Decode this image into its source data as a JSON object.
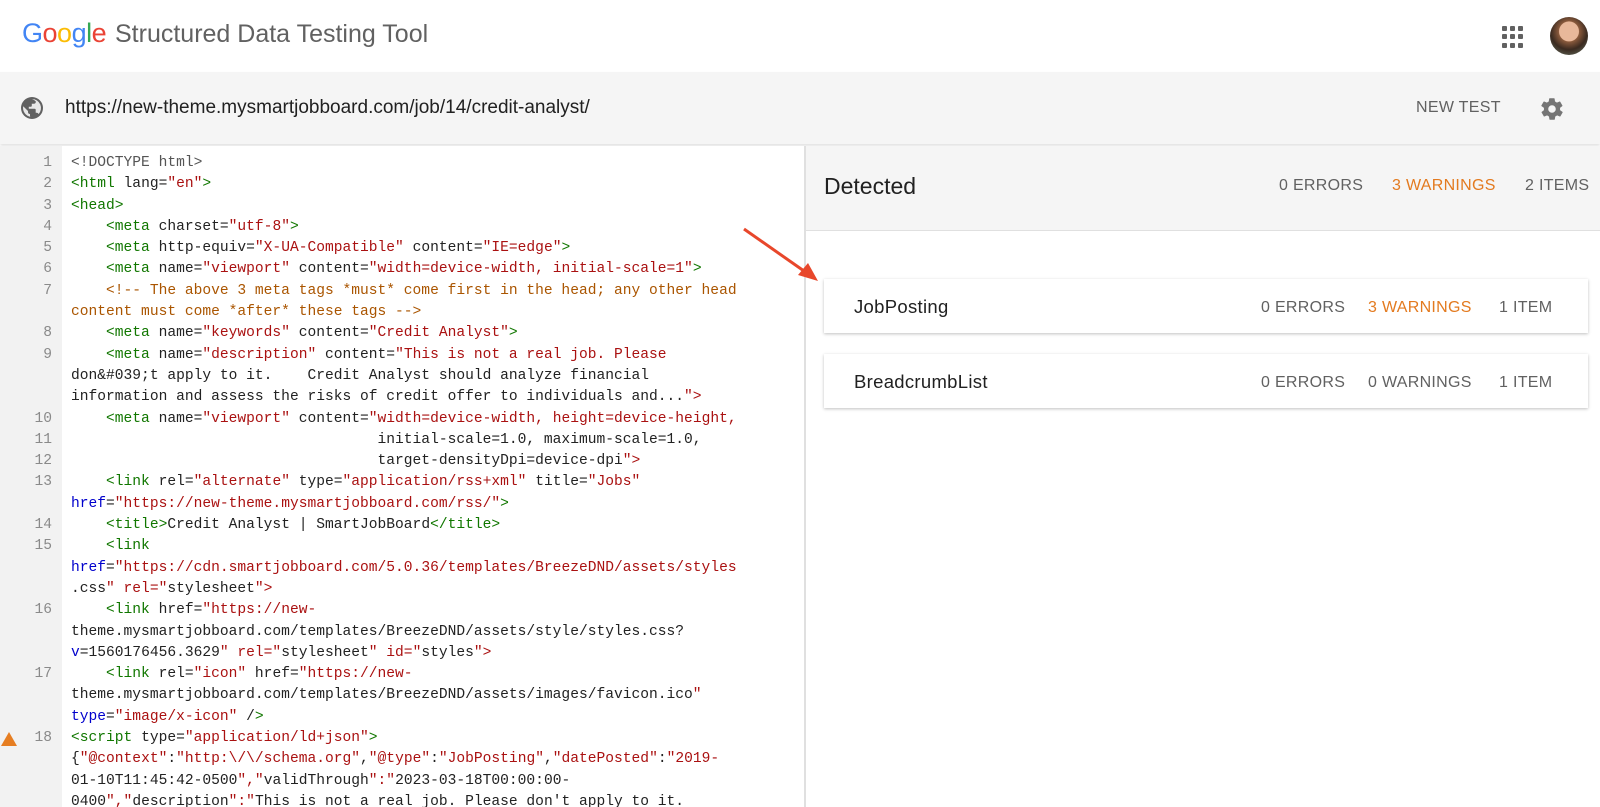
{
  "header": {
    "logo": {
      "G": "G",
      "o1": "o",
      "o2": "o",
      "g": "g",
      "l": "l",
      "e": "e"
    },
    "title": "Structured Data Testing Tool",
    "apps_icon": "apps-grid-icon",
    "avatar": "user-avatar"
  },
  "urlbar": {
    "icon": "globe-icon",
    "url": "https://new-theme.mysmartjobboard.com/job/14/credit-analyst/",
    "new_test_label": "NEW TEST",
    "settings_icon": "gear-icon"
  },
  "code": {
    "lines": [
      {
        "n": "1",
        "text": "<!DOCTYPE html>"
      },
      {
        "n": "2",
        "text": "<html lang=\"en\">"
      },
      {
        "n": "3",
        "text": "<head>"
      },
      {
        "n": "4",
        "text": "    <meta charset=\"utf-8\">"
      },
      {
        "n": "5",
        "text": "    <meta http-equiv=\"X-UA-Compatible\" content=\"IE=edge\">"
      },
      {
        "n": "6",
        "text": "    <meta name=\"viewport\" content=\"width=device-width, initial-scale=1\">"
      },
      {
        "n": "7",
        "text": "    <!-- The above 3 meta tags *must* come first in the head; any other head"
      },
      {
        "n": "",
        "text": "content must come *after* these tags -->"
      },
      {
        "n": "8",
        "text": "    <meta name=\"keywords\" content=\"Credit Analyst\">"
      },
      {
        "n": "9",
        "text": "    <meta name=\"description\" content=\"This is not a real job. Please"
      },
      {
        "n": "",
        "text": "don&#039;t apply to it.    Credit Analyst should analyze financial"
      },
      {
        "n": "",
        "text": "information and assess the risks of credit offer to individuals and...\">"
      },
      {
        "n": "10",
        "text": "    <meta name=\"viewport\" content=\"width=device-width, height=device-height,"
      },
      {
        "n": "11",
        "text": "                                   initial-scale=1.0, maximum-scale=1.0,"
      },
      {
        "n": "12",
        "text": "                                   target-densityDpi=device-dpi\">"
      },
      {
        "n": "13",
        "text": "    <link rel=\"alternate\" type=\"application/rss+xml\" title=\"Jobs\""
      },
      {
        "n": "",
        "text": "href=\"https://new-theme.mysmartjobboard.com/rss/\">"
      },
      {
        "n": "14",
        "text": "    <title>Credit Analyst | SmartJobBoard</title>"
      },
      {
        "n": "15",
        "text": "    <link"
      },
      {
        "n": "",
        "text": "href=\"https://cdn.smartjobboard.com/5.0.36/templates/BreezeDND/assets/styles"
      },
      {
        "n": "",
        "text": ".css\" rel=\"stylesheet\">"
      },
      {
        "n": "16",
        "text": "    <link href=\"https://new-"
      },
      {
        "n": "",
        "text": "theme.mysmartjobboard.com/templates/BreezeDND/assets/style/styles.css?"
      },
      {
        "n": "",
        "text": "v=1560176456.3629\" rel=\"stylesheet\" id=\"styles\">"
      },
      {
        "n": "17",
        "text": "    <link rel=\"icon\" href=\"https://new-"
      },
      {
        "n": "",
        "text": "theme.mysmartjobboard.com/templates/BreezeDND/assets/images/favicon.ico\""
      },
      {
        "n": "",
        "text": "type=\"image/x-icon\" />"
      },
      {
        "n": "18",
        "text": "<script type=\"application/ld+json\">",
        "warn": true
      },
      {
        "n": "",
        "text": "{\"@context\":\"http:\\/\\/schema.org\",\"@type\":\"JobPosting\",\"datePosted\":\"2019-"
      },
      {
        "n": "",
        "text": "01-10T11:45:42-0500\",\"validThrough\":\"2023-03-18T00:00:00-"
      },
      {
        "n": "",
        "text": "0400\",\"description\":\"This is not a real job. Please don't apply to it."
      }
    ]
  },
  "results": {
    "title": "Detected",
    "errors": "0 ERRORS",
    "warnings": "3 WARNINGS",
    "items": "2 ITEMS",
    "cards": [
      {
        "name": "JobPosting",
        "errors": "0 ERRORS",
        "warnings": "3 WARNINGS",
        "items": "1 ITEM",
        "has_warnings": true
      },
      {
        "name": "BreadcrumbList",
        "errors": "0 ERRORS",
        "warnings": "0 WARNINGS",
        "items": "1 ITEM",
        "has_warnings": false
      }
    ]
  },
  "colors": {
    "accent_warning": "#e37a1f",
    "arrow": "#e8472b"
  }
}
